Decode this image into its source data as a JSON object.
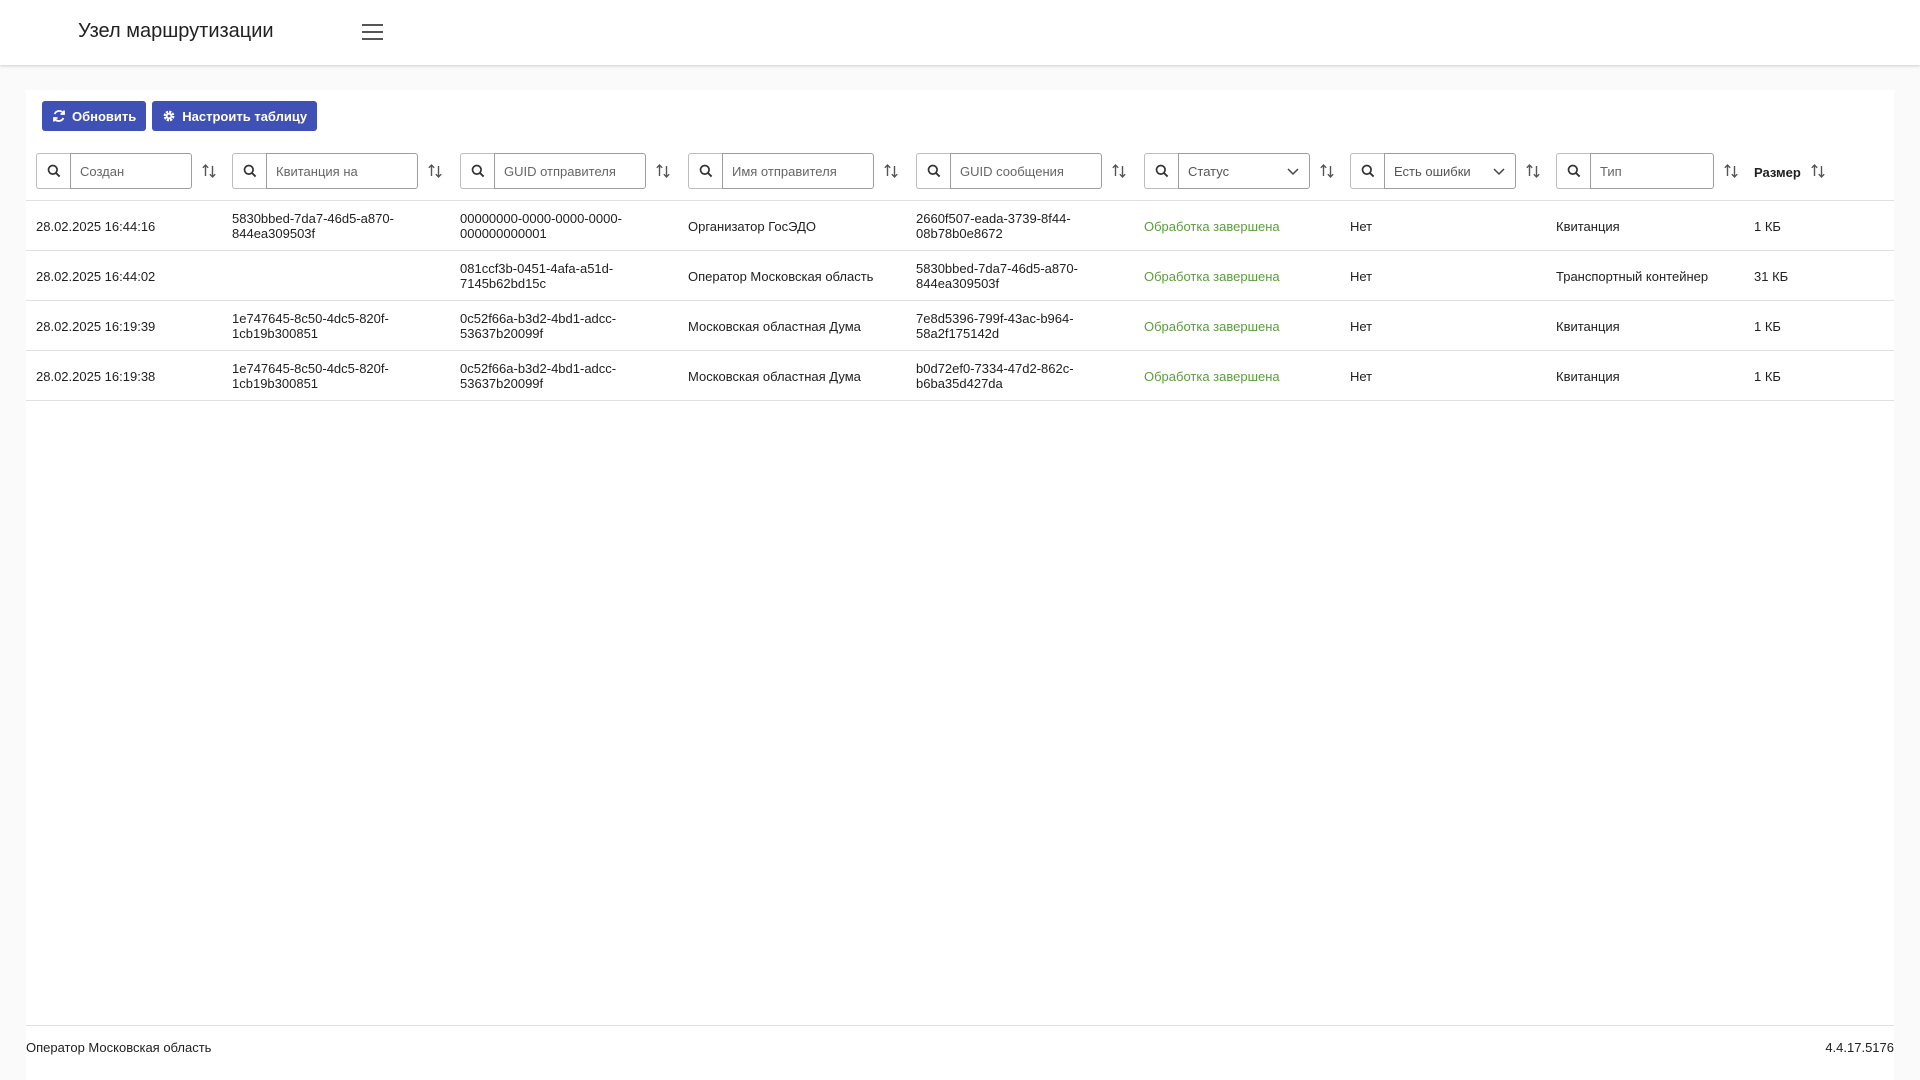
{
  "header": {
    "title": "Узел маршрутизации",
    "menu_icon": "hamburger-menu-icon"
  },
  "toolbar": {
    "refresh_label": "Обновить",
    "configure_label": "Настроить таблицу"
  },
  "filters": {
    "created": "Создан",
    "receipt_for": "Квитанция на",
    "sender_guid": "GUID отправителя",
    "sender_name": "Имя отправителя",
    "message_guid": "GUID сообщения",
    "status": "Статус",
    "has_errors": "Есть ошибки",
    "type": "Тип",
    "size": "Размер"
  },
  "table": {
    "rows": [
      {
        "created": "28.02.2025 16:44:16",
        "receipt_for_1": "5830bbed-7da7-46d5-a870-",
        "receipt_for_2": "844ea309503f",
        "sender_guid_1": "00000000-0000-0000-0000-",
        "sender_guid_2": "000000000001",
        "sender_name": "Организатор ГосЭДО",
        "message_guid_1": "2660f507-eada-3739-8f44-",
        "message_guid_2": "08b78b0e8672",
        "status": "Обработка завершена",
        "has_errors": "Нет",
        "type": "Квитанция",
        "size": "1 КБ"
      },
      {
        "created": "28.02.2025 16:44:02",
        "receipt_for_1": "",
        "receipt_for_2": "",
        "sender_guid_1": "081ccf3b-0451-4afa-a51d-",
        "sender_guid_2": "7145b62bd15c",
        "sender_name": "Оператор Московская область",
        "message_guid_1": "5830bbed-7da7-46d5-a870-",
        "message_guid_2": "844ea309503f",
        "status": "Обработка завершена",
        "has_errors": "Нет",
        "type": "Транспортный контейнер",
        "size": "31 КБ"
      },
      {
        "created": "28.02.2025 16:19:39",
        "receipt_for_1": "1e747645-8c50-4dc5-820f-",
        "receipt_for_2": "1cb19b300851",
        "sender_guid_1": "0c52f66a-b3d2-4bd1-adcc-",
        "sender_guid_2": "53637b20099f",
        "sender_name": "Московская областная Дума",
        "message_guid_1": "7e8d5396-799f-43ac-b964-",
        "message_guid_2": "58a2f175142d",
        "status": "Обработка завершена",
        "has_errors": "Нет",
        "type": "Квитанция",
        "size": "1 КБ"
      },
      {
        "created": "28.02.2025 16:19:38",
        "receipt_for_1": "1e747645-8c50-4dc5-820f-",
        "receipt_for_2": "1cb19b300851",
        "sender_guid_1": "0c52f66a-b3d2-4bd1-adcc-",
        "sender_guid_2": "53637b20099f",
        "sender_name": "Московская областная Дума",
        "message_guid_1": "b0d72ef0-7334-47d2-862c-",
        "message_guid_2": "b6ba35d427da",
        "status": "Обработка завершена",
        "has_errors": "Нет",
        "type": "Квитанция",
        "size": "1 КБ"
      }
    ]
  },
  "footer": {
    "operator": "Оператор Московская область",
    "version": "4.4.17.5176"
  },
  "colors": {
    "primary": "#3f51b5",
    "status_ok": "#5a9e3c"
  }
}
